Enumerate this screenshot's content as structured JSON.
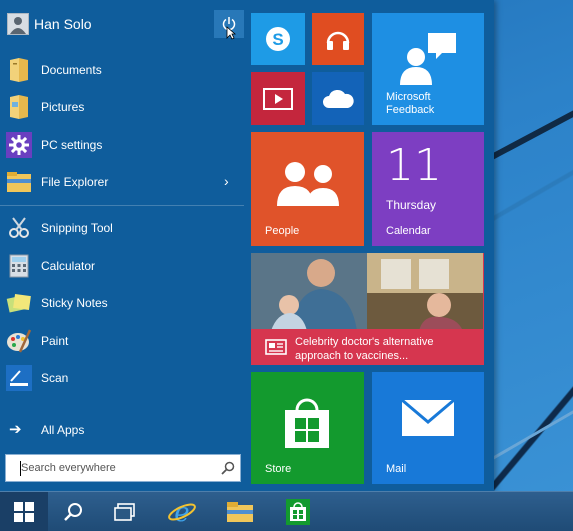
{
  "user": {
    "name": "Han Solo"
  },
  "left_items": [
    {
      "label": "Documents",
      "icon": "documents-folder-icon"
    },
    {
      "label": "Pictures",
      "icon": "pictures-folder-icon"
    },
    {
      "label": "PC settings",
      "icon": "gear-icon"
    },
    {
      "label": "File Explorer",
      "icon": "file-explorer-icon",
      "chevron": "›"
    },
    {
      "label": "Snipping Tool",
      "icon": "snipping-tool-icon"
    },
    {
      "label": "Calculator",
      "icon": "calculator-icon"
    },
    {
      "label": "Sticky Notes",
      "icon": "sticky-notes-icon"
    },
    {
      "label": "Paint",
      "icon": "paint-icon"
    },
    {
      "label": "Scan",
      "icon": "scan-icon"
    }
  ],
  "all_apps": {
    "label": "All Apps",
    "arrow": "➔"
  },
  "search": {
    "placeholder": "Search everywhere"
  },
  "tiles": {
    "skype": {
      "icon": "skype-icon",
      "color": "#1e9be6"
    },
    "music": {
      "icon": "headphones-icon",
      "color": "#e04d21"
    },
    "video": {
      "icon": "video-icon",
      "color": "#c4263d"
    },
    "onedrive": {
      "icon": "cloud-icon",
      "color": "#1363b8"
    },
    "feedback": {
      "label_line1": "Microsoft",
      "label_line2": "Feedback",
      "color": "#1e8fe3"
    },
    "people": {
      "label": "People",
      "color": "#e0532a"
    },
    "calendar": {
      "number": "11",
      "day": "Thursday",
      "label": "Calendar",
      "color": "#7d3ec2"
    },
    "news": {
      "headline_line1": "Celebrity doctor's alternative",
      "headline_line2": "approach to vaccines...",
      "color": "#d6364f"
    },
    "store": {
      "label": "Store",
      "color": "#139a2e"
    },
    "mail": {
      "label": "Mail",
      "color": "#1879d8"
    }
  },
  "taskbar": [
    "start-button",
    "search-icon",
    "task-view-icon",
    "internet-explorer-icon",
    "file-explorer-icon",
    "store-icon"
  ]
}
